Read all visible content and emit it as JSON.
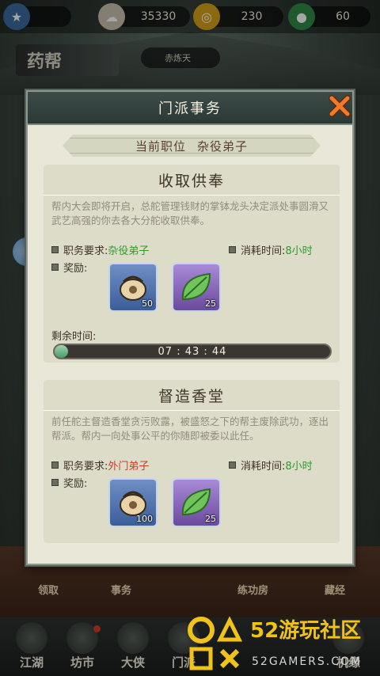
{
  "topbar": {
    "resources": [
      {
        "value": "",
        "icon": "level-icon"
      },
      {
        "value": "35330",
        "icon": "currency-icon"
      },
      {
        "value": "230",
        "icon": "gold-coin-icon"
      },
      {
        "value": "60",
        "icon": "jade-icon"
      }
    ]
  },
  "header": {
    "title": "药帮",
    "pill": "赤炼天"
  },
  "dialog": {
    "title": "门派事务",
    "position_label": "当前职位",
    "position_value": "杂役弟子",
    "tasks": [
      {
        "title": "收取供奉",
        "description": "帮内大会即将开启，总舵管理钱财的掌钵龙头决定派处事圆滑又武艺高强的你去各大分舵收取供奉。",
        "requirement_label": "职务要求:",
        "requirement_value": "杂役弟子",
        "time_label": "消耗时间:",
        "time_value": "8小时",
        "reward_label": "奖励:",
        "rewards": [
          {
            "icon": "token-pouch-icon",
            "count": "50"
          },
          {
            "icon": "green-leaf-icon",
            "count": "25"
          }
        ],
        "remaining_label": "剩余时间:",
        "remaining_value": "07 : 43 : 44",
        "progress": 0.03
      },
      {
        "title": "督造香堂",
        "description": "前任舵主督造香堂贪污败露，被盛怒之下的帮主废除武功，逐出帮派。帮内一向处事公平的你随即被委以此任。",
        "requirement_label": "职务要求:",
        "requirement_value": "外门弟子",
        "time_label": "消耗时间:",
        "time_value": "8小时",
        "reward_label": "奖励:",
        "rewards": [
          {
            "icon": "token-pouch-icon",
            "count": "100"
          },
          {
            "icon": "green-leaf-icon",
            "count": "25"
          }
        ]
      }
    ]
  },
  "background_labels": [
    "领取",
    "事务",
    "练功房",
    "藏经"
  ],
  "bottom_nav": [
    "江湖",
    "坊市",
    "大侠",
    "门派",
    "机缘"
  ],
  "watermark": {
    "brand": "52游玩社区",
    "site": "52GAMERS.COM"
  },
  "colors": {
    "requirement_ok": "#2f9a2a",
    "requirement_bad": "#d0392a",
    "accent": "#2b3835"
  }
}
